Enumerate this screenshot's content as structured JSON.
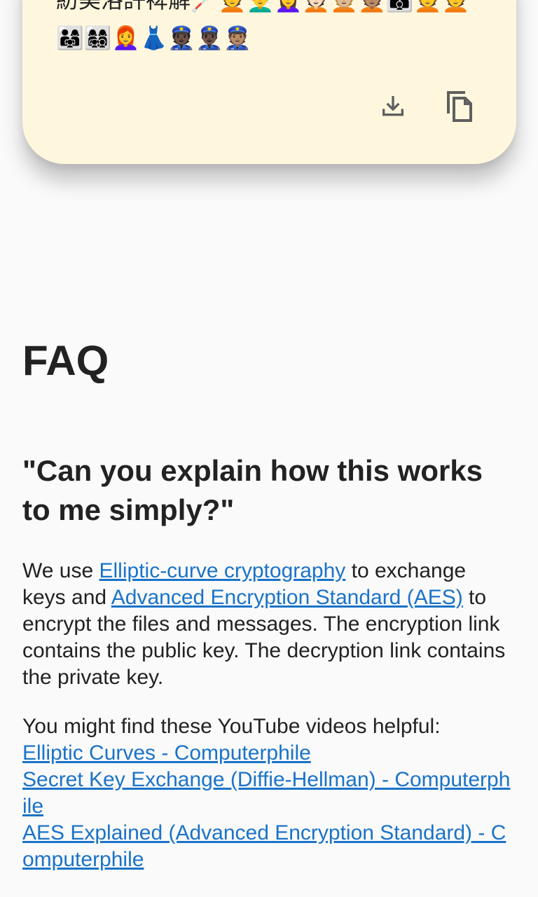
{
  "card": {
    "cipher_text_line1": "紡美洛許裨解🦯💆💆‍♂️💆‍♀️💆🏻💆🏼💆🏽👨‍👩‍👦💆💆",
    "cipher_text_line2": "👨‍👩‍👧👩‍👩‍👧‍👦👩‍🦰👗👮🏿👮🏿‍♂️👮🏽",
    "download_icon": "download-icon",
    "copy_icon": "copy-icon"
  },
  "faq": {
    "heading": "FAQ",
    "question": "\"Can you explain how this works to me simply?\"",
    "p1_before": "We use ",
    "p1_link1": "Elliptic-curve cryptography",
    "p1_mid": " to exchange keys and ",
    "p1_link2": "Advanced Encryption Standard (AES)",
    "p1_after": " to encrypt the files and messages. The encryption link contains the public key. The decryption link contains the private key.",
    "p2_intro": "You might find these YouTube videos helpful:",
    "videos": [
      "Elliptic Curves - Computerphile",
      "Secret Key Exchange (Diffie-Hellman) - Computerphile",
      "AES Explained (Advanced Encryption Standard) - Computerphile"
    ]
  },
  "colors": {
    "card_bg": "#fef7de",
    "link": "#1a73c8",
    "page_bg": "#fafafa"
  }
}
